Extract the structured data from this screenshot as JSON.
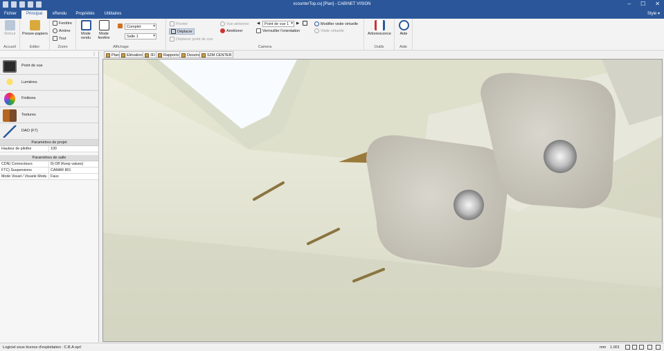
{
  "titlebar": {
    "title": "xcounterTop.cvj [Plan] - CABINET VISION",
    "minimize": "–",
    "maximize": "☐",
    "close": "✕"
  },
  "menu_tabs": [
    "Fichier",
    "Principal",
    "xRendu",
    "Propriétés",
    "Utilitaires"
  ],
  "style_label": "Style",
  "ribbon": {
    "accueil": {
      "retour": "Retour",
      "label": "Accueil"
    },
    "editer": {
      "presse": "Presse-papiers",
      "label": "Editer"
    },
    "zoom": {
      "fenetre": "Fenêtre",
      "arriere": "Arrière",
      "tout": "Tout",
      "label": "Zoom"
    },
    "affichage": {
      "mode_rendu": "Mode rendu",
      "mode_fenetre": "Mode fenêtre",
      "combo1": "Complet",
      "combo2": "Salle 1",
      "label": "Affichage"
    },
    "camera": {
      "pivoter": "Pivoter",
      "deplacer": "Déplacer",
      "deplacer_point": "Déplacer point de vue",
      "vue_aerienne": "Vue aérienne",
      "ameliorer": "Améliorer",
      "point_de_vue": "Point de vue 1",
      "verrouiller": "Verrouiller l'orientation",
      "modifier_visite": "Modifier visite virtuelle",
      "visite": "Visite virtuelle",
      "label": "Camera"
    },
    "outils": {
      "arborescence": "Arborescence",
      "label": "Outils"
    },
    "aide": {
      "aide": "Aide",
      "label": "Aide"
    }
  },
  "left_panel": {
    "nav": [
      "Point de vue",
      "Lumières",
      "Finitions",
      "Textures",
      "DAO (F7)"
    ],
    "projet_header": "Paramètres de projet",
    "projet_rows": [
      {
        "k": "Hauteur de plinthe",
        "v": "100"
      }
    ],
    "salle_header": "Paramètres de salle",
    "salle_rows": [
      {
        "k": "CDN) Connecteurs",
        "v": "8) Off (Keep values)"
      },
      {
        "k": "FTC) Suspensions",
        "v": "CAMAR 801"
      },
      {
        "k": "Mode Visuel / Visuele Modu",
        "v": "Faux"
      }
    ]
  },
  "view_tabs": [
    "Plan",
    "Elévation",
    "3D",
    "Rapports",
    "Dessins",
    "S2M CENTER"
  ],
  "statusbar": {
    "text": "Logiciel sous licence d'exploitation : C.B.A sprl",
    "unit": "mm",
    "scale": "1.001"
  },
  "colors": {
    "accent": "#2b579a",
    "ribbon": "#f3f3f3"
  }
}
